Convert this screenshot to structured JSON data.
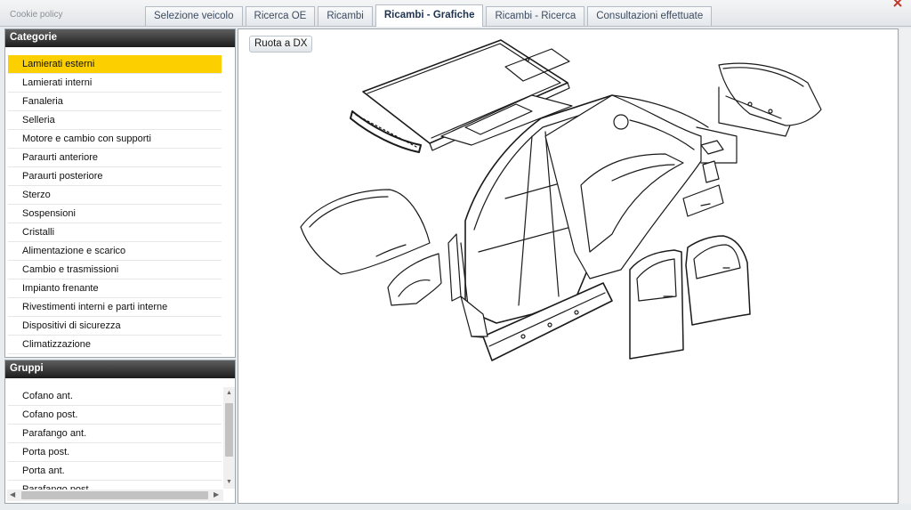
{
  "topbar": {
    "cookie_label": "Cookie policy",
    "tabs": [
      {
        "label": "Selezione veicolo",
        "active": false
      },
      {
        "label": "Ricerca OE",
        "active": false
      },
      {
        "label": "Ricambi",
        "active": false
      },
      {
        "label": "Ricambi - Grafiche",
        "active": true
      },
      {
        "label": "Ricambi - Ricerca",
        "active": false
      },
      {
        "label": "Consultazioni effettuate",
        "active": false
      }
    ]
  },
  "categories": {
    "title": "Categorie",
    "selected": "Lamierati esterni",
    "items": [
      "Lamierati esterni",
      "Lamierati interni",
      "Fanaleria",
      "Selleria",
      "Motore e cambio con supporti",
      "Paraurti anteriore",
      "Paraurti posteriore",
      "Sterzo",
      "Sospensioni",
      "Cristalli",
      "Alimentazione e scarico",
      "Cambio e trasmissioni",
      "Impianto frenante",
      "Rivestimenti interni e parti interne",
      "Dispositivi di sicurezza",
      "Climatizzazione"
    ]
  },
  "groups": {
    "title": "Gruppi",
    "items": [
      "Cofano ant.",
      "Cofano post.",
      "Parafango ant.",
      "Porta post.",
      "Porta ant.",
      "Parafango post."
    ]
  },
  "main": {
    "rotate_label": "Ruota a DX"
  },
  "colors": {
    "selected_bg": "#fcd000",
    "panel_header": "#2a2a2a",
    "tab_text": "#3d4c60"
  },
  "icons": {
    "drawing": "exploded-car-body-diagram"
  }
}
